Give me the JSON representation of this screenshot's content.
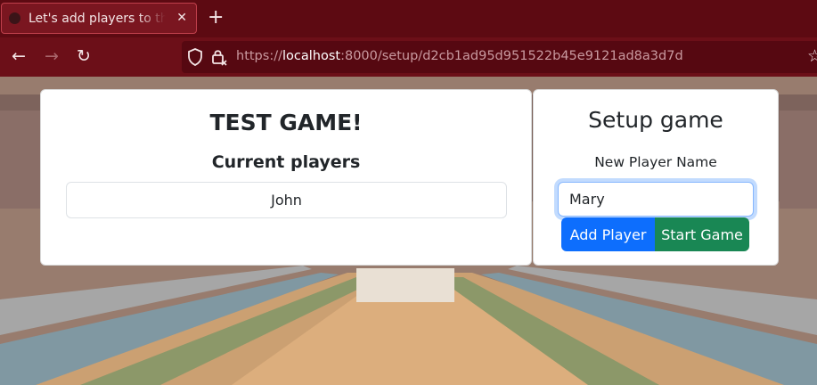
{
  "browser": {
    "tab_title": "Let's add players to the game",
    "tab_close": "✕",
    "new_tab": "+",
    "back": "←",
    "forward": "→",
    "reload": "↻",
    "url_scheme": "https://",
    "url_host": "localhost",
    "url_rest": ":8000/setup/d2cb1ad95d951522b45e9121ad8a3d7d",
    "bookmark": "☆"
  },
  "game": {
    "title": "TEST GAME!",
    "players_heading": "Current players",
    "players": [
      "John"
    ]
  },
  "setup": {
    "title": "Setup game",
    "new_player_label": "New Player Name",
    "new_player_value": "Mary",
    "add_player_label": "Add Player",
    "start_game_label": "Start Game"
  },
  "colors": {
    "primary": "#0d6efd",
    "success": "#198754",
    "chrome": "#6c0f18"
  }
}
